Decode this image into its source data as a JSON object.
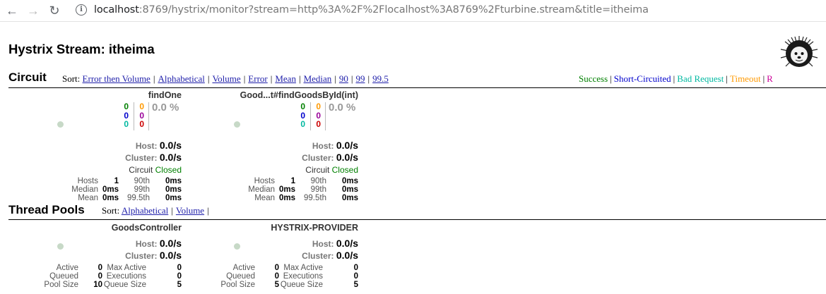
{
  "browser": {
    "url_host": "localhost",
    "url_rest": ":8769/hystrix/monitor?stream=http%3A%2F%2Flocalhost%3A8769%2Fturbine.stream&title=itheima"
  },
  "page": {
    "title": "Hystrix Stream: itheima"
  },
  "circuit": {
    "heading": "Circuit",
    "sort_label": "Sort:",
    "sort_options": [
      "Error then Volume",
      "Alphabetical",
      "Volume",
      "Error",
      "Mean",
      "Median",
      "90",
      "99",
      "99.5"
    ],
    "legend": [
      {
        "label": "Success",
        "color": "#008000"
      },
      {
        "label": "Short-Circuited",
        "color": "#0000cc"
      },
      {
        "label": "Bad Request",
        "color": "#00b8a0"
      },
      {
        "label": "Timeout",
        "color": "#ff9900"
      },
      {
        "label": "R",
        "color": "#cc0099"
      }
    ],
    "boxes": [
      {
        "name": "findOne",
        "c_success": "0",
        "c_short": "0",
        "c_bad": "0",
        "c_timeout": "0",
        "c_reject": "0",
        "c_failure": "0",
        "error_rate": "0.0 %",
        "host_label": "Host:",
        "host_rate": "0.0/s",
        "cluster_label": "Cluster:",
        "cluster_rate": "0.0/s",
        "circuit_label": "Circuit",
        "circuit_state": "Closed",
        "hosts_label": "Hosts",
        "hosts": "1",
        "median_label": "Median",
        "median": "0ms",
        "mean_label": "Mean",
        "mean": "0ms",
        "p90_label": "90th",
        "p90": "0ms",
        "p99_label": "99th",
        "p99": "0ms",
        "p995_label": "99.5th",
        "p995": "0ms"
      },
      {
        "name": "Good...t#findGoodsById(int)",
        "c_success": "0",
        "c_short": "0",
        "c_bad": "0",
        "c_timeout": "0",
        "c_reject": "0",
        "c_failure": "0",
        "error_rate": "0.0 %",
        "host_label": "Host:",
        "host_rate": "0.0/s",
        "cluster_label": "Cluster:",
        "cluster_rate": "0.0/s",
        "circuit_label": "Circuit",
        "circuit_state": "Closed",
        "hosts_label": "Hosts",
        "hosts": "1",
        "median_label": "Median",
        "median": "0ms",
        "mean_label": "Mean",
        "mean": "0ms",
        "p90_label": "90th",
        "p90": "0ms",
        "p99_label": "99th",
        "p99": "0ms",
        "p995_label": "99.5th",
        "p995": "0ms"
      }
    ]
  },
  "threadpools": {
    "heading": "Thread Pools",
    "sort_label": "Sort:",
    "sort_options": [
      "Alphabetical",
      "Volume"
    ],
    "boxes": [
      {
        "name": "GoodsController",
        "host_label": "Host:",
        "host_rate": "0.0/s",
        "cluster_label": "Cluster:",
        "cluster_rate": "0.0/s",
        "active_label": "Active",
        "active": "0",
        "queued_label": "Queued",
        "queued": "0",
        "poolsize_label": "Pool Size",
        "poolsize": "10",
        "maxactive_label": "Max Active",
        "maxactive": "0",
        "executions_label": "Executions",
        "executions": "0",
        "queuesize_label": "Queue Size",
        "queuesize": "5"
      },
      {
        "name": "HYSTRIX-PROVIDER",
        "host_label": "Host:",
        "host_rate": "0.0/s",
        "cluster_label": "Cluster:",
        "cluster_rate": "0.0/s",
        "active_label": "Active",
        "active": "0",
        "queued_label": "Queued",
        "queued": "0",
        "poolsize_label": "Pool Size",
        "poolsize": "5",
        "maxactive_label": "Max Active",
        "maxactive": "0",
        "executions_label": "Executions",
        "executions": "0",
        "queuesize_label": "Queue Size",
        "queuesize": "5"
      }
    ]
  },
  "colors": {
    "success": "#008000",
    "short": "#0000cc",
    "bad": "#00b8a0",
    "timeout": "#ff9900",
    "reject": "#990099",
    "failure": "#cc0000",
    "bubble": "#c7d9c7"
  }
}
